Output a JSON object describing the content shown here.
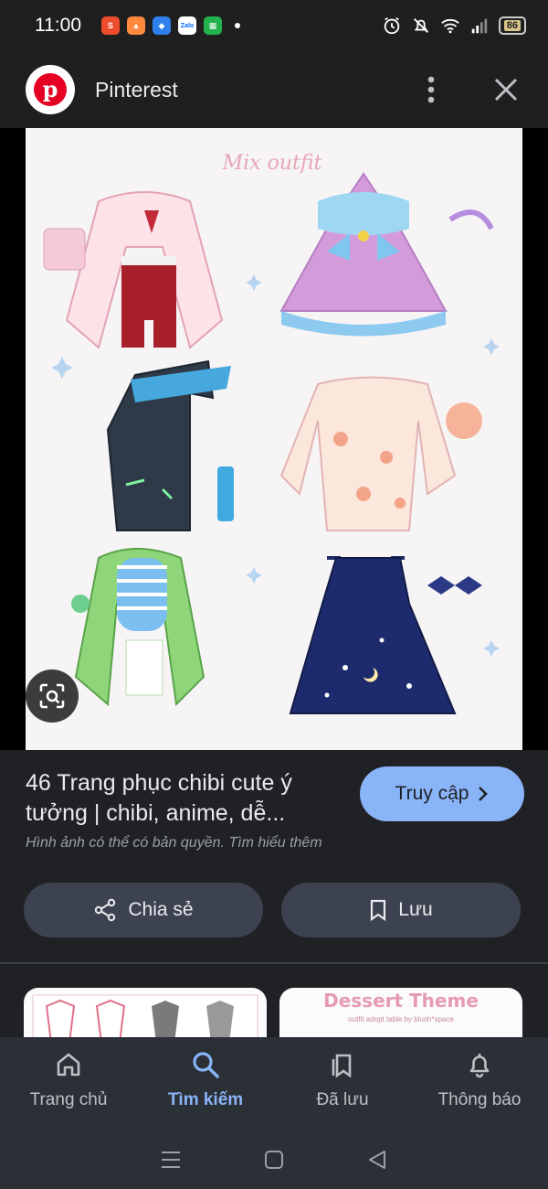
{
  "status": {
    "time": "11:00",
    "battery": "86",
    "apps": [
      {
        "icon": "shopee-icon",
        "color": "#ee4d2d",
        "glyph": "S"
      },
      {
        "icon": "game-icon",
        "color": "#ff8a3d",
        "glyph": "▲"
      },
      {
        "icon": "app-icon",
        "color": "#2f80ed",
        "glyph": "◆"
      },
      {
        "icon": "zalo-icon",
        "color": "#ffffff",
        "glyph": "Zalo"
      },
      {
        "icon": "grab-icon",
        "color": "#22b14c",
        "glyph": "▦"
      }
    ]
  },
  "header": {
    "title": "Pinterest",
    "brand_color": "#e60023"
  },
  "pin": {
    "image_text": "Mix outfit",
    "title": "46 Trang phục chibi cute ý tưởng | chibi, anime, dễ...",
    "subtitle": "Hình ảnh có thể có bản quyền. Tìm hiểu thêm",
    "visit_label": "Truy cập"
  },
  "actions": {
    "share_label": "Chia sẻ",
    "save_label": "Lưu"
  },
  "related": {
    "second_title": "Dessert Theme",
    "second_subtitle": "outfit adopt table by blush*space"
  },
  "nav": {
    "items": [
      {
        "label": "Trang chủ",
        "icon": "home-icon",
        "active": false
      },
      {
        "label": "Tìm kiếm",
        "icon": "search-icon",
        "active": true
      },
      {
        "label": "Đã lưu",
        "icon": "bookmarks-icon",
        "active": false
      },
      {
        "label": "Thông báo",
        "icon": "bell-icon",
        "active": false
      }
    ]
  },
  "colors": {
    "accent": "#8ab4f8",
    "background": "#202124",
    "button_bg": "#3c4250",
    "nav_bg": "#2b2f36"
  }
}
